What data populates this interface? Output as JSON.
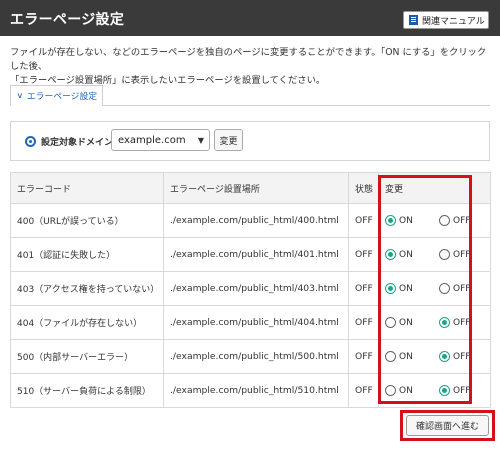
{
  "header": {
    "title": "エラーページ設定",
    "manual_button": "関連マニュアル",
    "manual_icon": "book-icon"
  },
  "description": {
    "line1": "ファイルが存在しない、などのエラーページを独自のページに変更することができます。「ON にする」をクリックした後、",
    "line2": "「エラーページ設置場所」に表示したいエラーページを設置してください。"
  },
  "tab": {
    "label": "エラーページ設定",
    "icon": "chevron-down-icon"
  },
  "domain": {
    "label": "設定対象ドメイン",
    "selected": "example.com",
    "change_button": "変更"
  },
  "table": {
    "headers": [
      "エラーコード",
      "エラーページ設置場所",
      "状態",
      "変更"
    ],
    "on_label": "ON",
    "off_label": "OFF",
    "rows": [
      {
        "code": "400（URLが誤っている）",
        "path": "./example.com/public_html/400.html",
        "state": "OFF",
        "selected": "on"
      },
      {
        "code": "401（認証に失敗した）",
        "path": "./example.com/public_html/401.html",
        "state": "OFF",
        "selected": "on"
      },
      {
        "code": "403（アクセス権を持っていない）",
        "path": "./example.com/public_html/403.html",
        "state": "OFF",
        "selected": "on"
      },
      {
        "code": "404（ファイルが存在しない）",
        "path": "./example.com/public_html/404.html",
        "state": "OFF",
        "selected": "off"
      },
      {
        "code": "500（内部サーバーエラー）",
        "path": "./example.com/public_html/500.html",
        "state": "OFF",
        "selected": "off"
      },
      {
        "code": "510（サーバー負荷による制限）",
        "path": "./example.com/public_html/510.html",
        "state": "OFF",
        "selected": "off"
      }
    ]
  },
  "confirm_button": "確認画面へ進む",
  "colors": {
    "header_bg": "#3a3a3a",
    "accent_blue": "#2166b8",
    "radio_green": "#1aa58a",
    "highlight_red": "#d4111a"
  }
}
